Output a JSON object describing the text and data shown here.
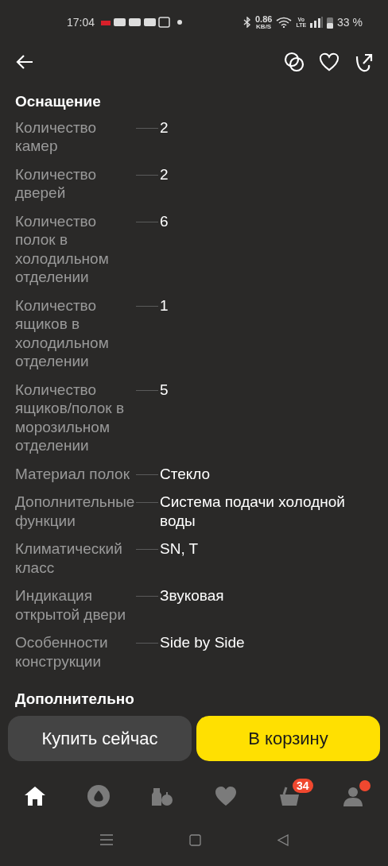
{
  "status_bar": {
    "time": "17:04",
    "speed": "0.86",
    "speed_unit": "KB/S",
    "volte_top": "Vo",
    "volte_bottom": "LTE",
    "battery": "33 %"
  },
  "section": {
    "title": "Оснащение",
    "rows": [
      {
        "label": "Количество камер",
        "value": "2"
      },
      {
        "label": "Количество дверей",
        "value": "2"
      },
      {
        "label": "Количество полок в холодильном отделении",
        "value": "6"
      },
      {
        "label": "Количество ящиков в холодильном отделении",
        "value": "1"
      },
      {
        "label": "Количество ящиков/полок в морозильном отделении",
        "value": "5"
      },
      {
        "label": "Материал полок",
        "value": "Стекло"
      },
      {
        "label": "Дополнительные функции",
        "value": "Система подачи холодной воды"
      },
      {
        "label": "Климатический класс",
        "value": "SN, T"
      },
      {
        "label": "Индикация открытой двери",
        "value": "Звуковая"
      },
      {
        "label": "Особенности конструкции",
        "value": "Side by Side"
      }
    ]
  },
  "next_section": {
    "title": "Дополнительно"
  },
  "actions": [
    {
      "kind": "secondary",
      "label": "Купить сейчас"
    },
    {
      "kind": "primary",
      "label": "В корзину"
    }
  ],
  "nav": [
    {
      "kind": "home",
      "selected": true
    },
    {
      "kind": "assistant",
      "selected": false
    },
    {
      "kind": "catalog",
      "selected": false
    },
    {
      "kind": "favorites",
      "selected": false
    },
    {
      "kind": "cart",
      "selected": false,
      "badge": "34"
    },
    {
      "kind": "profile",
      "selected": false,
      "dot": true
    }
  ]
}
